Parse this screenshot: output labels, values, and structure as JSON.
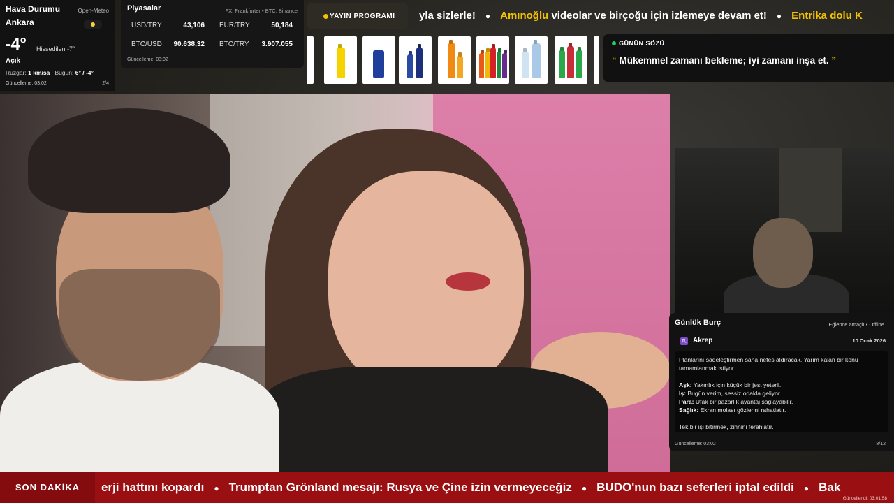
{
  "weather": {
    "title": "Hava Durumu",
    "source": "Open-Meteo",
    "city": "Ankara",
    "temperature": "-4°",
    "feels_like": "Hissedilen -7°",
    "condition": "Açık",
    "wind_label": "Rüzgar:",
    "wind_value": "1 km/sa",
    "today_label": "Bugün:",
    "today_value": "6° / -4°",
    "updated": "Güncelleme: 03:02",
    "page": "2/4",
    "icon": "sun-icon"
  },
  "markets": {
    "title": "Piyasalar",
    "source": "FX: Frankfurter • BTC: Binance",
    "rates": [
      {
        "pair": "USD/TRY",
        "value": "43,106"
      },
      {
        "pair": "EUR/TRY",
        "value": "50,184"
      },
      {
        "pair": "BTC/USD",
        "value": "90.638,32"
      },
      {
        "pair": "BTC/TRY",
        "value": "3.907.055"
      }
    ],
    "updated": "Güncelleme: 03:02"
  },
  "schedule": {
    "label": "YAYIN PROGRAMI"
  },
  "top_ticker": {
    "items": [
      {
        "text": "yla sizlerle!",
        "style": "w"
      },
      {
        "text": "Amınoğlu",
        "style": "y"
      },
      {
        "text": " videolar ve birçoğu için izlemeye devam et!",
        "style": "w"
      },
      {
        "text": "Entrika dolu K",
        "style": "y"
      }
    ]
  },
  "products": [
    {
      "name": "yellow-drink-bottle",
      "colors": [
        "#f6d200"
      ]
    },
    {
      "name": "blue-can",
      "colors": [
        "#1f3f9b"
      ]
    },
    {
      "name": "blue-bottles",
      "colors": [
        "#2b4aa3",
        "#1c2f7a"
      ]
    },
    {
      "name": "orange-bottles",
      "colors": [
        "#f08a12",
        "#f5a623"
      ]
    },
    {
      "name": "mixed-soda-bottles",
      "colors": [
        "#e85a17",
        "#d32227",
        "#f2b705",
        "#1d8a3b",
        "#6a2a8c"
      ]
    },
    {
      "name": "water-bottles",
      "colors": [
        "#cfe3f2",
        "#a9c9e6"
      ]
    },
    {
      "name": "green-red-bottles",
      "colors": [
        "#2aa84a",
        "#c82d3a",
        "#2aa84a"
      ]
    }
  ],
  "quote": {
    "label": "GÜNÜN SÖZÜ",
    "open": "“",
    "text": "Mükemmel zamanı bekleme; iyi zamanı inşa et.",
    "close": "”"
  },
  "horoscope": {
    "title": "Günlük Burç",
    "meta": "Eğlence amaçlı • Offline",
    "sign": "Akrep",
    "date": "10 Ocak 2026",
    "intro": "Planlarını sadeleştirmen sana nefes aldıracak. Yarım kalan bir konu tamamlanmak istiyor.",
    "lines": [
      {
        "k": "Aşk:",
        "v": " Yakınlık için küçük bir jest yeterli."
      },
      {
        "k": "İş:",
        "v": " Bugün verim, sessiz odakla geliyor."
      },
      {
        "k": "Para:",
        "v": " Ufak bir pazarlık avantaj sağlayabilir."
      },
      {
        "k": "Sağlık:",
        "v": " Ekran molası gözlerini rahatlatır."
      }
    ],
    "advice": "Tek bir işi bitirmek, zihnini ferahlatır.",
    "updated": "Güncelleme: 03:02",
    "page": "8/12"
  },
  "breaking": {
    "label": "SON DAKİKA",
    "items": [
      "erji hattını kopardı",
      "Trumptan Grönland mesajı: Rusya ve Çine izin vermeyeceğiz",
      "BUDO'nun bazı seferleri iptal edildi",
      "Bak"
    ],
    "updated": "Güncellendi: 03:01:58"
  }
}
